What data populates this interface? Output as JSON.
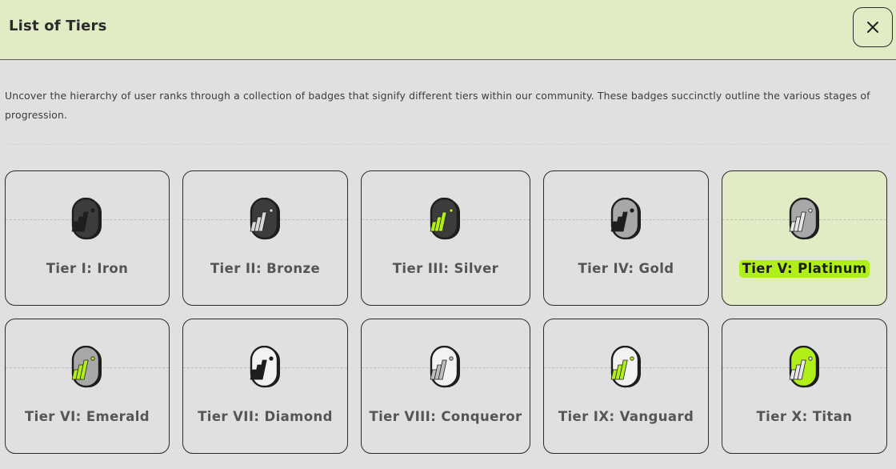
{
  "header": {
    "title": "List of Tiers",
    "close_icon": "close-icon"
  },
  "description": "Uncover the hierarchy of user ranks through a collection of badges that signify different tiers within our community. These badges succinctly outline the various stages of progression.",
  "colors": {
    "header_bg": "#e1ebc4",
    "page_bg": "#e0e0e0",
    "accent": "#b0ef1a",
    "border": "#2b2b2b"
  },
  "tiers": [
    {
      "label": "Tier I: Iron",
      "icon": "iron-badge-icon",
      "selected": false
    },
    {
      "label": "Tier II: Bronze",
      "icon": "bronze-badge-icon",
      "selected": false
    },
    {
      "label": "Tier III: Silver",
      "icon": "silver-badge-icon",
      "selected": false
    },
    {
      "label": "Tier IV: Gold",
      "icon": "gold-badge-icon",
      "selected": false
    },
    {
      "label": "Tier V: Platinum",
      "icon": "platinum-badge-icon",
      "selected": true
    },
    {
      "label": "Tier VI: Emerald",
      "icon": "emerald-badge-icon",
      "selected": false
    },
    {
      "label": "Tier VII: Diamond",
      "icon": "diamond-badge-icon",
      "selected": false
    },
    {
      "label": "Tier VIII: Conqueror",
      "icon": "conqueror-badge-icon",
      "selected": false
    },
    {
      "label": "Tier IX: Vanguard",
      "icon": "vanguard-badge-icon",
      "selected": false
    },
    {
      "label": "Tier X: Titan",
      "icon": "titan-badge-icon",
      "selected": false
    }
  ]
}
